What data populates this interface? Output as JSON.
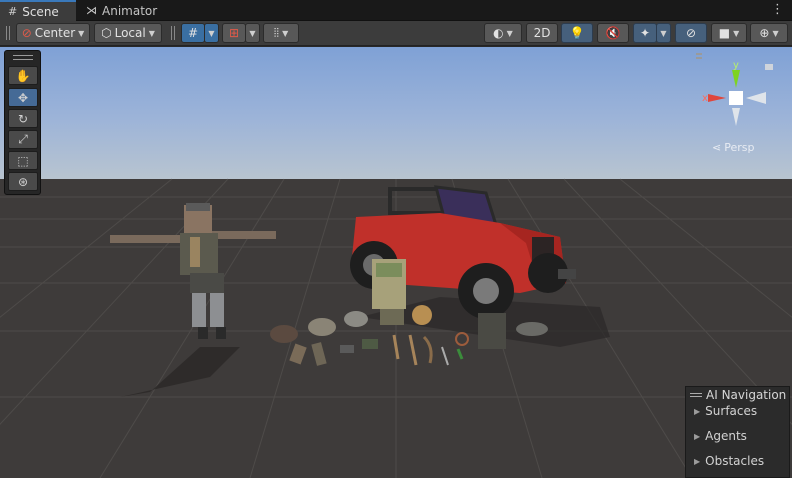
{
  "tabs": [
    {
      "label": "Scene",
      "icon": "grid-icon",
      "active": true
    },
    {
      "label": "Animator",
      "icon": "animator-icon",
      "active": false
    }
  ],
  "toolbar": {
    "pivot_label": "Center",
    "space_label": "Local",
    "toggle_2d_label": "2D"
  },
  "gizmo": {
    "y_label": "y",
    "x_label": "x",
    "projection_label": "Persp"
  },
  "ai_navigation": {
    "title": "AI Navigation",
    "items": [
      "Surfaces",
      "Agents",
      "Obstacles"
    ]
  },
  "colors": {
    "accent_blue": "#3a79bb",
    "active_tool": "#456a96",
    "sky_top": "#7fa1d6",
    "ground": "#3e3b3a",
    "gizmo_y": "#7ed321",
    "gizmo_x": "#e0463c",
    "jeep_body": "#c0302a"
  }
}
